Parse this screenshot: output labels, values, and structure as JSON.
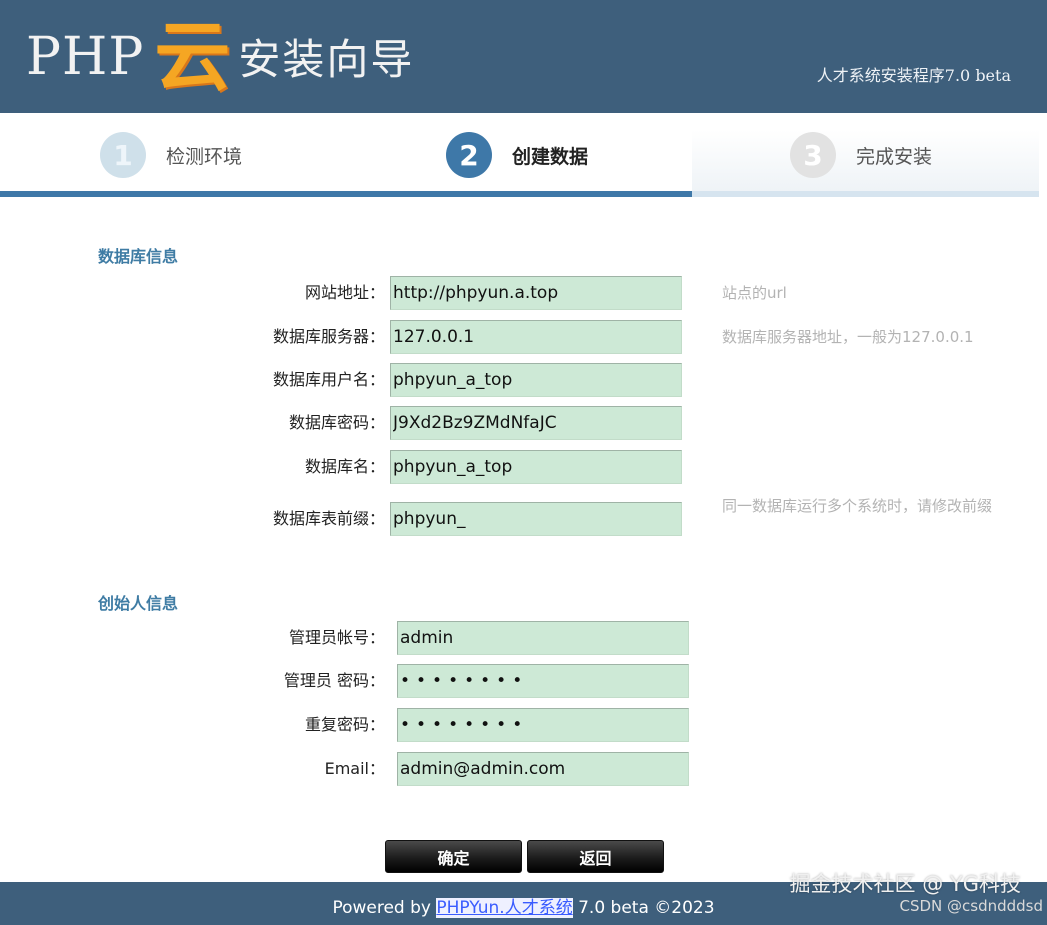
{
  "header": {
    "logo_php": "PHP",
    "logo_cloud": "云",
    "logo_title": "安装向导",
    "right_text": "人才系统安装程序7.0 beta"
  },
  "steps": [
    {
      "num": "1",
      "label": "检测环境",
      "state": "done"
    },
    {
      "num": "2",
      "label": "创建数据",
      "state": "active"
    },
    {
      "num": "3",
      "label": "完成安装",
      "state": "pending"
    }
  ],
  "progress": {
    "fraction": 0.666
  },
  "db_section": {
    "title": "数据库信息",
    "fields": [
      {
        "label": "网站地址：",
        "value": "http://phpyun.a.top",
        "hint": "站点的url"
      },
      {
        "label": "数据库服务器：",
        "value": "127.0.0.1",
        "hint": "数据库服务器地址，一般为127.0.0.1"
      },
      {
        "label": "数据库用户名：",
        "value": "phpyun_a_top",
        "hint": ""
      },
      {
        "label": "数据库密码：",
        "value": "J9Xd2Bz9ZMdNfaJC",
        "hint": ""
      },
      {
        "label": "数据库名：",
        "value": "phpyun_a_top",
        "hint": ""
      },
      {
        "label": "数据库表前缀：",
        "value": "phpyun_",
        "hint": "同一数据库运行多个系统时，请修改前缀"
      }
    ]
  },
  "admin_section": {
    "title": "创始人信息",
    "fields": [
      {
        "label": "管理员帐号：",
        "value": "admin"
      },
      {
        "label": "管理员 密码：",
        "value": "••••••••"
      },
      {
        "label": "重复密码：",
        "value": "••••••••"
      },
      {
        "label": "Email：",
        "value": "admin@admin.com"
      }
    ]
  },
  "buttons": {
    "confirm": "确定",
    "back": "返回"
  },
  "footer": {
    "prefix": "Powered by ",
    "link": "PHPYun.人才系统",
    "suffix": " 7.0 beta ©2023"
  },
  "watermark": {
    "line1": "掘金技术社区 @ YG科技",
    "line2": "CSDN @csdndddsd"
  },
  "colors": {
    "header_bg": "#3e5f7c",
    "accent": "#3e78a8",
    "section_title": "#3f7ca4",
    "field_bg": "#cde9d6"
  }
}
